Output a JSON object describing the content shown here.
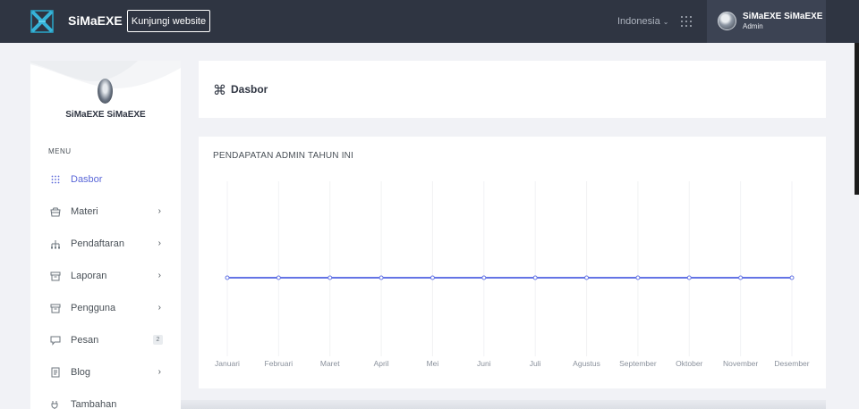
{
  "app": {
    "brand": "SiMaEXE",
    "visit_button": "Kunjungi website",
    "language": "Indonesia",
    "user_name": "SiMaEXE SiMaEXE",
    "user_role": "Admin"
  },
  "sidebar": {
    "profile_name": "SiMaEXE SiMaEXE",
    "menu_title": "MENU",
    "items": [
      {
        "label": "Dasbor",
        "icon": "dots-grid-icon"
      },
      {
        "label": "Materi",
        "icon": "basket-icon"
      },
      {
        "label": "Pendaftaran",
        "icon": "sitemap-icon"
      },
      {
        "label": "Laporan",
        "icon": "archive-icon"
      },
      {
        "label": "Pengguna",
        "icon": "archive-icon"
      },
      {
        "label": "Pesan",
        "icon": "chat-icon",
        "badge": "2"
      },
      {
        "label": "Blog",
        "icon": "document-icon"
      },
      {
        "label": "Tambahan",
        "icon": "plug-icon"
      }
    ]
  },
  "page": {
    "title": "Dasbor"
  },
  "colors": {
    "topbar": "#2f3542",
    "accent": "#5a67d8",
    "line": "#6474e5"
  },
  "chart_data": {
    "type": "line",
    "title": "PENDAPATAN ADMIN TAHUN INI",
    "categories": [
      "Januari",
      "Februari",
      "Maret",
      "April",
      "Mei",
      "Juni",
      "Juli",
      "Agustus",
      "September",
      "Oktober",
      "November",
      "Desember"
    ],
    "values": [
      0,
      0,
      0,
      0,
      0,
      0,
      0,
      0,
      0,
      0,
      0,
      0
    ],
    "grid": "vertical"
  }
}
